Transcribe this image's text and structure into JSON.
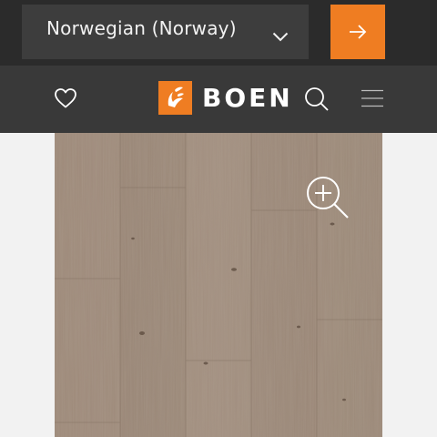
{
  "language_bar": {
    "selected_language": "Norwegian (Norway)",
    "dropdown_icon": "chevron-down-icon",
    "submit_icon": "arrow-right-icon",
    "submit_color": "#ef7d22"
  },
  "header": {
    "favorites_icon": "heart-icon",
    "logo_text": "BOEN",
    "logo_color": "#ef7d22",
    "search_icon": "search-icon",
    "menu_icon": "hamburger-menu-icon"
  },
  "product": {
    "image": "oak-wood-floor-texture",
    "zoom_icon": "zoom-in-icon"
  }
}
